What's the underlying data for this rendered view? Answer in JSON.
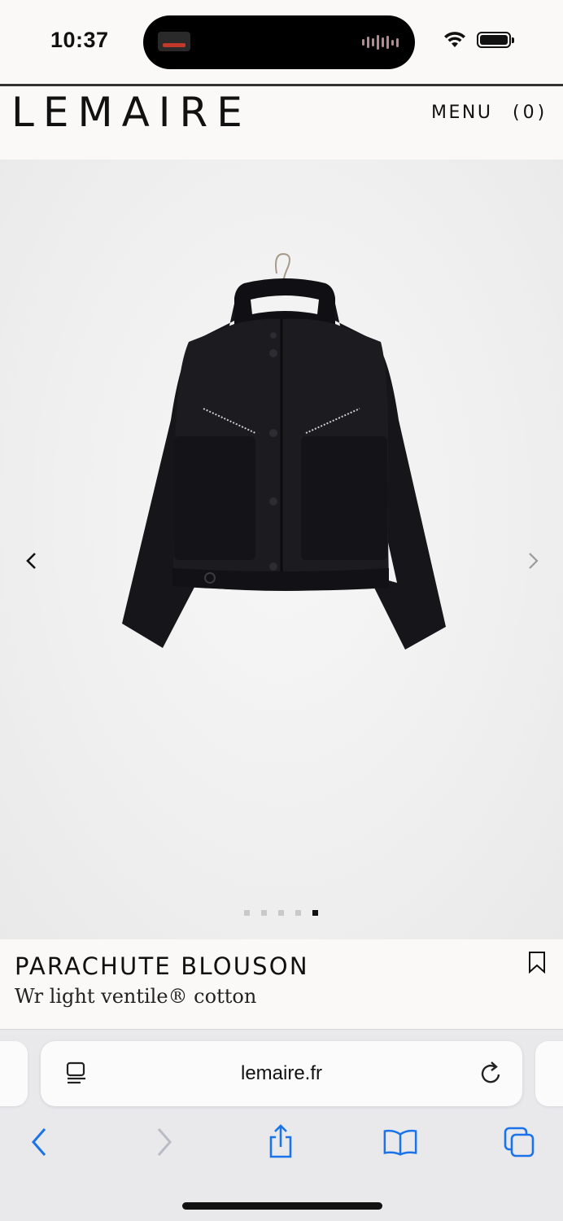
{
  "status_bar": {
    "time": "10:37"
  },
  "header": {
    "brand": "LEMAIRE",
    "menu_label": "MENU",
    "cart_label": "(0)"
  },
  "product": {
    "title": "PARACHUTE BLOUSON",
    "subtitle": "Wr light ventile® cotton",
    "gallery": {
      "total_images": 5,
      "active_index": 5
    }
  },
  "browser": {
    "url": "lemaire.fr",
    "accent_color": "#1a73e8"
  },
  "icons": {
    "reader": "reader-mode-icon",
    "reload": "reload-icon",
    "back": "back-icon",
    "forward": "forward-icon",
    "share": "share-icon",
    "bookmarks": "bookmarks-icon",
    "tabs": "tabs-icon",
    "bookmark": "bookmark-icon"
  }
}
